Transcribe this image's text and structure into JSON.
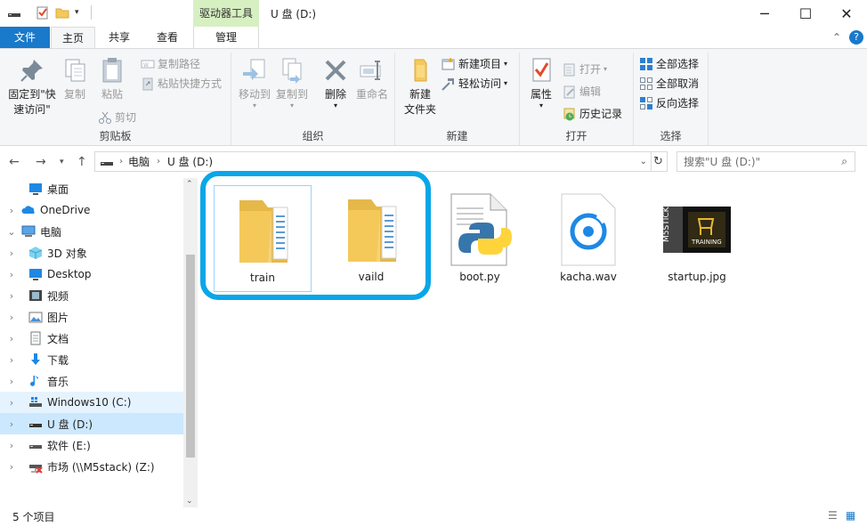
{
  "title_bar": {
    "context_tab": "驱动器工具",
    "window_title": "U 盘 (D:)",
    "minimize": "─",
    "maximize": "☐",
    "close": "✕"
  },
  "ribbon_tabs": {
    "file": "文件",
    "home": "主页",
    "share": "共享",
    "view": "查看",
    "manage": "管理"
  },
  "ribbon": {
    "clipboard": {
      "label": "剪贴板",
      "pin": "固定到\"快\n速访问\"",
      "copy": "复制",
      "paste": "粘贴",
      "copy_path": "复制路径",
      "paste_shortcut": "粘贴快捷方式",
      "cut": "剪切"
    },
    "organize": {
      "label": "组织",
      "move_to": "移动到",
      "copy_to": "复制到",
      "delete": "删除",
      "rename": "重命名"
    },
    "new": {
      "label": "新建",
      "new_folder": "新建\n文件夹",
      "new_item": "新建项目",
      "easy_access": "轻松访问"
    },
    "open": {
      "label": "打开",
      "properties": "属性",
      "open": "打开",
      "edit": "编辑",
      "history": "历史记录"
    },
    "select": {
      "label": "选择",
      "select_all": "全部选择",
      "select_none": "全部取消",
      "invert": "反向选择"
    }
  },
  "address": {
    "path": [
      "电脑",
      "U 盘 (D:)"
    ],
    "search_placeholder": "搜索\"U 盘 (D:)\""
  },
  "nav_pane": [
    {
      "label": "桌面",
      "icon": "desktop-icon",
      "indent": 1,
      "chevron": false
    },
    {
      "label": "OneDrive",
      "icon": "onedrive-icon",
      "indent": 0,
      "chevron": "right"
    },
    {
      "label": "电脑",
      "icon": "computer-icon",
      "indent": 0,
      "chevron": "down"
    },
    {
      "label": "3D 对象",
      "icon": "3d-objects-icon",
      "indent": 1,
      "chevron": "right"
    },
    {
      "label": "Desktop",
      "icon": "desktop-icon",
      "indent": 1,
      "chevron": "right"
    },
    {
      "label": "视频",
      "icon": "video-icon",
      "indent": 1,
      "chevron": "right"
    },
    {
      "label": "图片",
      "icon": "pictures-icon",
      "indent": 1,
      "chevron": "right"
    },
    {
      "label": "文档",
      "icon": "documents-icon",
      "indent": 1,
      "chevron": "right"
    },
    {
      "label": "下载",
      "icon": "downloads-icon",
      "indent": 1,
      "chevron": "right"
    },
    {
      "label": "音乐",
      "icon": "music-icon",
      "indent": 1,
      "chevron": "right"
    },
    {
      "label": "Windows10 (C:)",
      "icon": "windows-drive-icon",
      "indent": 1,
      "chevron": "right"
    },
    {
      "label": "U 盘 (D:)",
      "icon": "usb-drive-icon",
      "indent": 1,
      "chevron": "right"
    },
    {
      "label": "软件 (E:)",
      "icon": "drive-icon",
      "indent": 1,
      "chevron": "right"
    },
    {
      "label": "市场 (\\\\M5stack) (Z:)",
      "icon": "network-drive-icon",
      "indent": 1,
      "chevron": "right"
    }
  ],
  "files": [
    {
      "name": "train",
      "icon": "folder-icon"
    },
    {
      "name": "vaild",
      "icon": "folder-icon"
    },
    {
      "name": "boot.py",
      "icon": "python-file-icon"
    },
    {
      "name": "kacha.wav",
      "icon": "audio-file-icon"
    },
    {
      "name": "startup.jpg",
      "icon": "image-file-icon"
    }
  ],
  "status": {
    "item_count": "5 个项目"
  },
  "colors": {
    "file_tab": "#1979ca",
    "context_tab": "#d7f0c2",
    "highlight_border": "#0aa6e8",
    "selection_border": "#99d1ff",
    "folder": "#f4c95a"
  }
}
